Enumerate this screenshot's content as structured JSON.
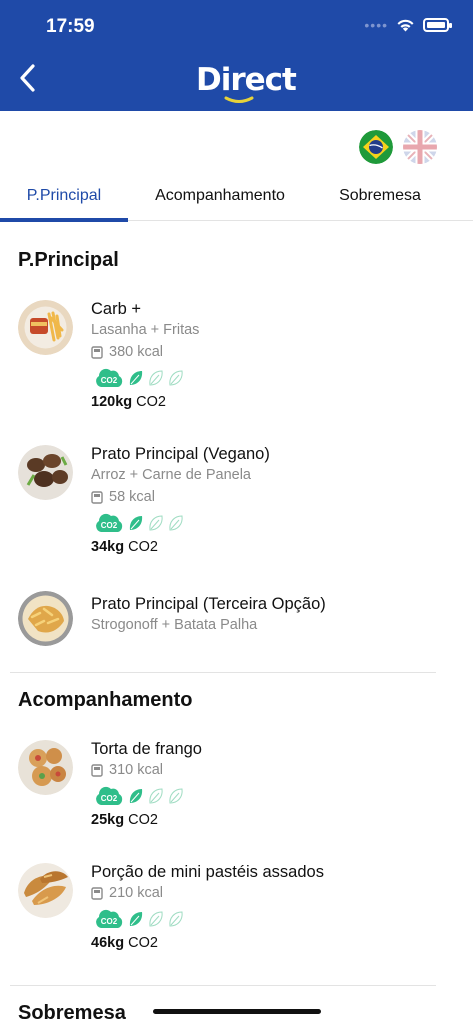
{
  "status": {
    "time": "17:59"
  },
  "header": {
    "logo_text": "Direct"
  },
  "tabs": [
    {
      "label": "P.Principal",
      "active": true
    },
    {
      "label": "Acompanhamento",
      "active": false
    },
    {
      "label": "Sobremesa",
      "active": false
    }
  ],
  "sections": [
    {
      "title": "P.Principal",
      "items": [
        {
          "name": "Carb +",
          "desc": "Lasanha + Fritas",
          "kcal": "380 kcal",
          "leaves_filled": 1,
          "leaves_total": 3,
          "co2_amount": "120kg",
          "co2_unit": "CO2"
        },
        {
          "name": "Prato Principal (Vegano)",
          "desc": "Arroz + Carne de Panela",
          "kcal": "58 kcal",
          "leaves_filled": 1,
          "leaves_total": 3,
          "co2_amount": "34kg",
          "co2_unit": "CO2"
        },
        {
          "name": "Prato Principal (Terceira Opção)",
          "desc": "Strogonoff + Batata Palha"
        }
      ]
    },
    {
      "title": "Acompanhamento",
      "items": [
        {
          "name": "Torta de frango",
          "kcal": "310 kcal",
          "leaves_filled": 1,
          "leaves_total": 3,
          "co2_amount": "25kg",
          "co2_unit": "CO2"
        },
        {
          "name": "Porção de mini pastéis assados",
          "kcal": "210 kcal",
          "leaves_filled": 1,
          "leaves_total": 3,
          "co2_amount": "46kg",
          "co2_unit": "CO2"
        }
      ]
    },
    {
      "title": "Sobremesa"
    }
  ],
  "badge_label": "CO2",
  "colors": {
    "brand_blue": "#1f4aa8",
    "leaf_green": "#2fbe8a",
    "logo_yellow": "#e6d23a"
  },
  "icons": [
    "back-arrow-icon",
    "wifi-icon",
    "battery-icon",
    "brazil-flag-icon",
    "uk-flag-icon",
    "calorie-icon",
    "co2-cloud-icon",
    "leaf-icon"
  ]
}
